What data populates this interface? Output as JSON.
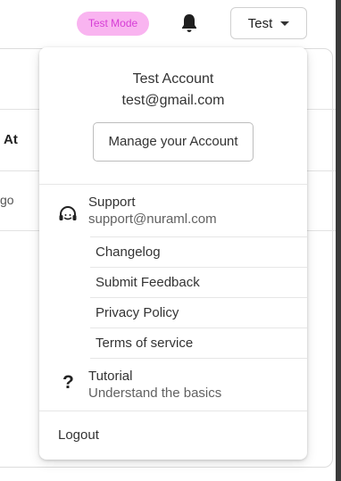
{
  "header": {
    "mode_badge": "Test Mode",
    "notifications_icon": "bell-icon",
    "user_menu_label": "Test",
    "user_menu_icon": "caret-down-icon"
  },
  "background": {
    "column_header": "At",
    "row_value": "go"
  },
  "account_menu": {
    "account_name": "Test Account",
    "account_email": "test@gmail.com",
    "manage_label": "Manage your Account",
    "support": {
      "icon": "headset-icon",
      "title": "Support",
      "email": "support@nuraml.com"
    },
    "links": [
      "Changelog",
      "Submit Feedback",
      "Privacy Policy",
      "Terms of service"
    ],
    "tutorial": {
      "icon": "question-mark-icon",
      "title": "Tutorial",
      "subtitle": "Understand the basics"
    },
    "logout_label": "Logout"
  },
  "colors": {
    "badge_bg": "#f9b4f0",
    "badge_text": "#d63dd6"
  }
}
